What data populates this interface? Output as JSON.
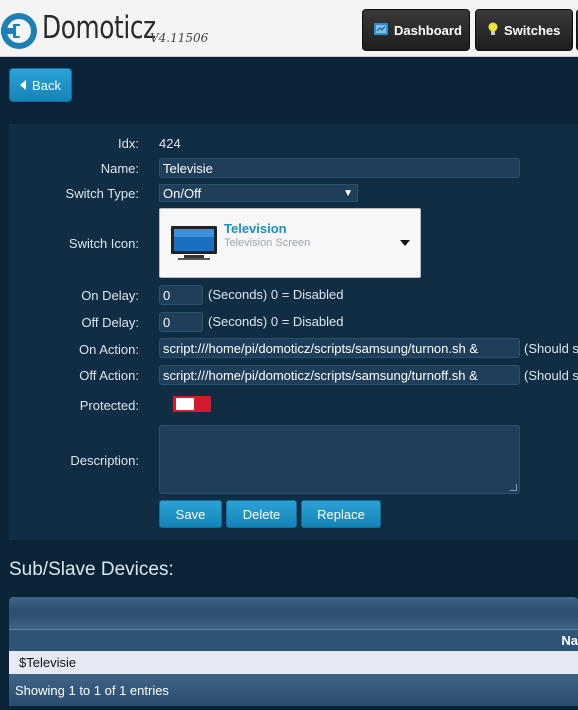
{
  "header": {
    "logo_text": "Domoticz",
    "version": "V4.11506",
    "nav": [
      {
        "label": "Dashboard",
        "icon": "dashboard-icon"
      },
      {
        "label": "Switches",
        "icon": "lightbulb-icon"
      }
    ]
  },
  "back_label": "Back",
  "form": {
    "idx_label": "Idx:",
    "idx_value": "424",
    "name_label": "Name:",
    "name_value": "Televisie",
    "switch_type_label": "Switch Type:",
    "switch_type_value": "On/Off",
    "switch_icon_label": "Switch Icon:",
    "icon_title": "Television",
    "icon_subtitle": "Television Screen",
    "on_delay_label": "On Delay:",
    "on_delay_value": "0",
    "on_delay_hint": "(Seconds) 0 = Disabled",
    "off_delay_label": "Off Delay:",
    "off_delay_value": "0",
    "off_delay_hint": "(Seconds) 0 = Disabled",
    "on_action_label": "On Action:",
    "on_action_value": "script:///home/pi/domoticz/scripts/samsung/turnon.sh &",
    "on_action_hint": "(Should s",
    "off_action_label": "Off Action:",
    "off_action_value": "script:///home/pi/domoticz/scripts/samsung/turnoff.sh &",
    "off_action_hint": "(Should s",
    "protected_label": "Protected:",
    "description_label": "Description:",
    "buttons": {
      "save": "Save",
      "delete": "Delete",
      "replace": "Replace"
    }
  },
  "sub_devices": {
    "title": "Sub/Slave Devices:",
    "column_header": "Na",
    "rows": [
      "$Televisie"
    ],
    "footer": "Showing 1 to 1 of 1 entries"
  },
  "colors": {
    "accent": "#1a8ec5",
    "toggle": "#d41a2e",
    "background": "#0b2336"
  }
}
